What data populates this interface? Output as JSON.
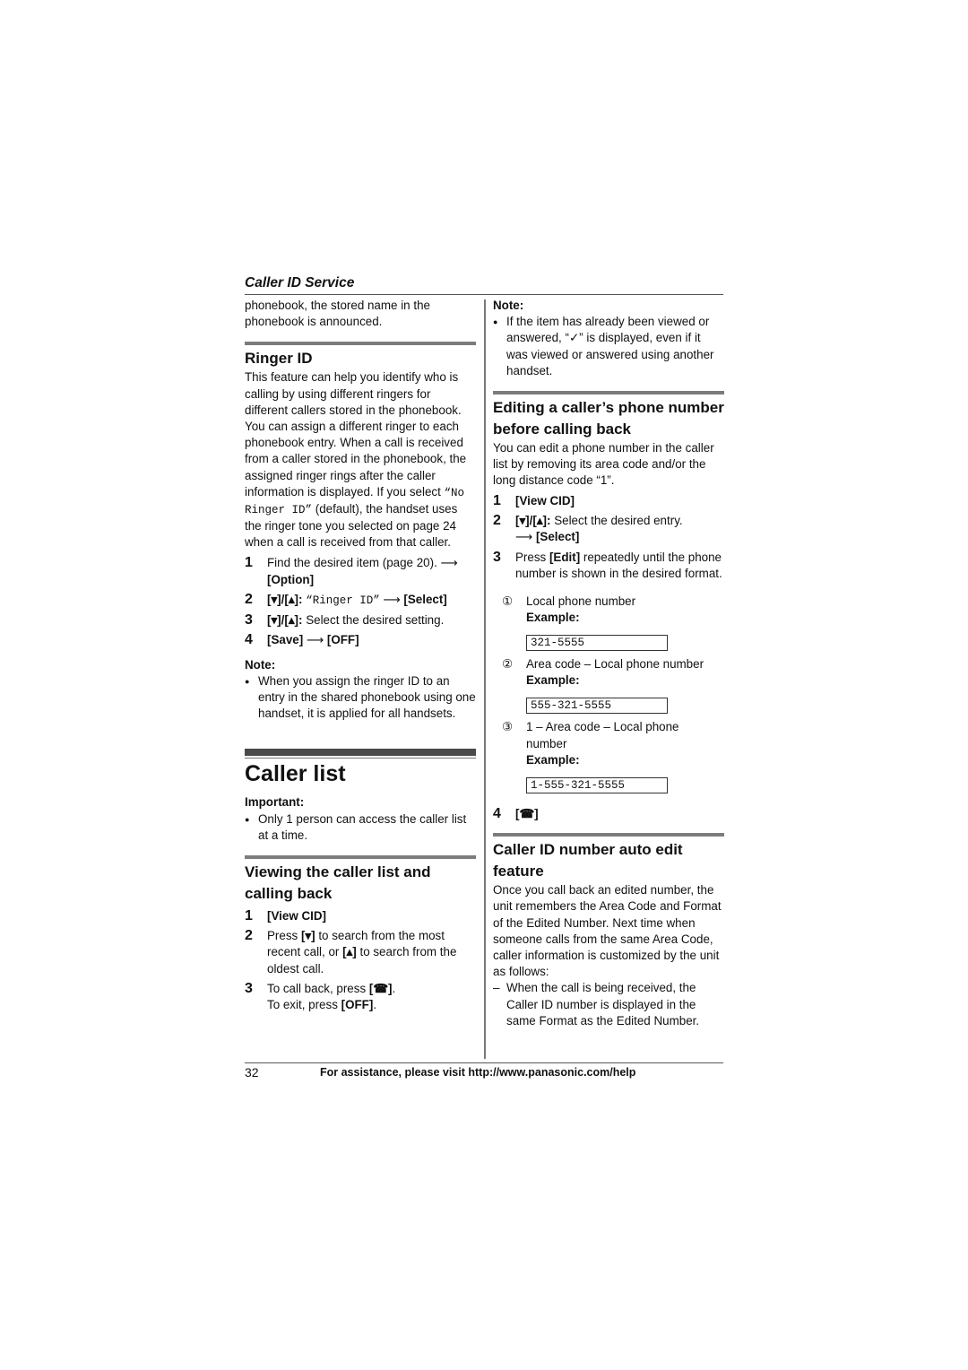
{
  "header": {
    "running_title": "Caller ID Service"
  },
  "left": {
    "intro_continuation": "phonebook, the stored name in the phonebook is announced.",
    "ringer_id": {
      "heading": "Ringer ID",
      "body_before": "This feature can help you identify who is calling by using different ringers for different callers stored in the phonebook. You can assign a different ringer to each phonebook entry. When a call is received from a caller stored in the phonebook, the assigned ringer rings after the caller information is displayed. If you select ",
      "body_mono": "“No Ringer ID”",
      "body_after": " (default), the handset uses the ringer tone you selected on page 24 when a call is received from that caller.",
      "steps": [
        {
          "num": "1",
          "text": "Find the desired item (page 20).",
          "arrow": "⟶",
          "key": "[Option]"
        },
        {
          "num": "2",
          "keys": "[▾]/[▴]:",
          "mono": "“Ringer ID”",
          "arrow": "⟶",
          "key": "[Select]"
        },
        {
          "num": "3",
          "keys": "[▾]/[▴]:",
          "text": "Select the desired setting."
        },
        {
          "num": "4",
          "key": "[Save]",
          "arrow": "⟶",
          "key2": "[OFF]"
        }
      ],
      "note_label": "Note:",
      "note_bullet": "●",
      "note_text": "When you assign the ringer ID to an entry in the shared phonebook using one handset, it is applied for all handsets."
    },
    "caller_list": {
      "heading": "Caller list",
      "important_label": "Important:",
      "important_bullet": "●",
      "important_text": "Only 1 person can access the caller list at a time."
    },
    "viewing": {
      "heading": "Viewing the caller list and calling back",
      "steps": [
        {
          "num": "1",
          "key": "[View CID]"
        },
        {
          "num": "2",
          "pre": "Press ",
          "k1": "[▾]",
          "mid": " to search from the most recent call, or ",
          "k2": "[▴]",
          "post": " to search from the oldest call."
        },
        {
          "num": "3",
          "pre": "To call back, press ",
          "k1": "[☎]",
          "post": ".",
          "line2_pre": "To exit, press ",
          "k2": "[OFF]",
          "line2_post": "."
        }
      ]
    }
  },
  "right": {
    "note_label": "Note:",
    "note_bullet": "●",
    "note_text": "If the item has already been viewed or answered, “✓” is displayed, even if it was viewed or answered using another handset.",
    "editing": {
      "heading": "Editing a caller’s phone number before calling back",
      "body": "You can edit a phone number in the caller list by removing its area code and/or the long distance code “1”.",
      "steps": [
        {
          "num": "1",
          "key": "[View CID]"
        },
        {
          "num": "2",
          "keys": "[▾]/[▴]:",
          "text": "Select the desired entry.",
          "arrow": "⟶",
          "key": "[Select]"
        },
        {
          "num": "3",
          "pre": "Press ",
          "key": "[Edit]",
          "post": " repeatedly until the phone number is shown in the desired format."
        }
      ],
      "formats": [
        {
          "marker": "①",
          "label": "Local phone number",
          "example_label": "Example:",
          "example": "321-5555"
        },
        {
          "marker": "②",
          "label": "Area code – Local phone number",
          "example_label": "Example:",
          "example": "555-321-5555"
        },
        {
          "marker": "③",
          "label": "1 – Area code – Local phone number",
          "example_label": "Example:",
          "example": "1-555-321-5555"
        }
      ],
      "step4": {
        "num": "4",
        "key": "[☎]"
      }
    },
    "auto_edit": {
      "heading": "Caller ID number auto edit feature",
      "body": "Once you call back an edited number, the unit remembers the Area Code and Format of the Edited Number. Next time when someone calls from the same Area Code, caller information is customized by the unit as follows:",
      "dash": "–",
      "item": "When the call is being received, the Caller ID number is displayed in the same Format as the Edited Number."
    }
  },
  "footer": {
    "page_number": "32",
    "assistance": "For assistance, please visit http://www.panasonic.com/help"
  }
}
